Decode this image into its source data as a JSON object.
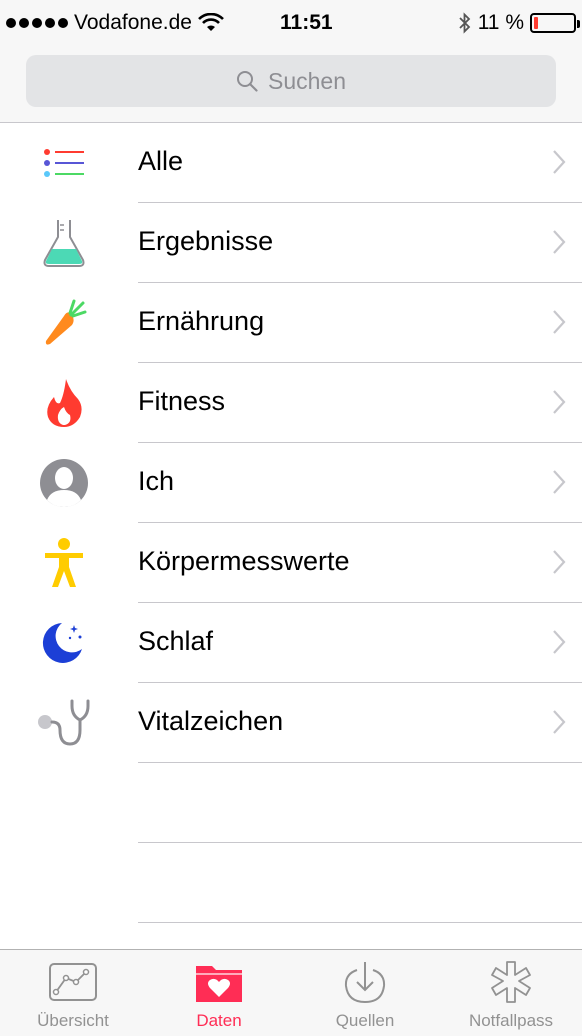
{
  "status_bar": {
    "carrier": "Vodafone.de",
    "time": "11:51",
    "battery": "11 %",
    "battery_level": 0.11,
    "icons": [
      "signal-dots-icon",
      "wifi-icon",
      "bluetooth-icon",
      "battery-icon"
    ]
  },
  "search": {
    "placeholder": "Suchen"
  },
  "categories": [
    {
      "label": "Alle",
      "icon": "list-icon"
    },
    {
      "label": "Ergebnisse",
      "icon": "flask-icon"
    },
    {
      "label": "Ernährung",
      "icon": "carrot-icon"
    },
    {
      "label": "Fitness",
      "icon": "flame-icon"
    },
    {
      "label": "Ich",
      "icon": "person-icon"
    },
    {
      "label": "Körpermesswerte",
      "icon": "body-icon"
    },
    {
      "label": "Schlaf",
      "icon": "moon-icon"
    },
    {
      "label": "Vitalzeichen",
      "icon": "stethoscope-icon"
    }
  ],
  "tabs": [
    {
      "label": "Übersicht",
      "icon": "chart-icon",
      "active": false
    },
    {
      "label": "Daten",
      "icon": "folder-heart-icon",
      "active": true
    },
    {
      "label": "Quellen",
      "icon": "download-icon",
      "active": false
    },
    {
      "label": "Notfallpass",
      "icon": "asterisk-icon",
      "active": false
    }
  ],
  "colors": {
    "accent": "#ff2d55",
    "tab_inactive": "#929292",
    "separator": "#c8c7cc",
    "battery_low": "#ff3b30"
  }
}
